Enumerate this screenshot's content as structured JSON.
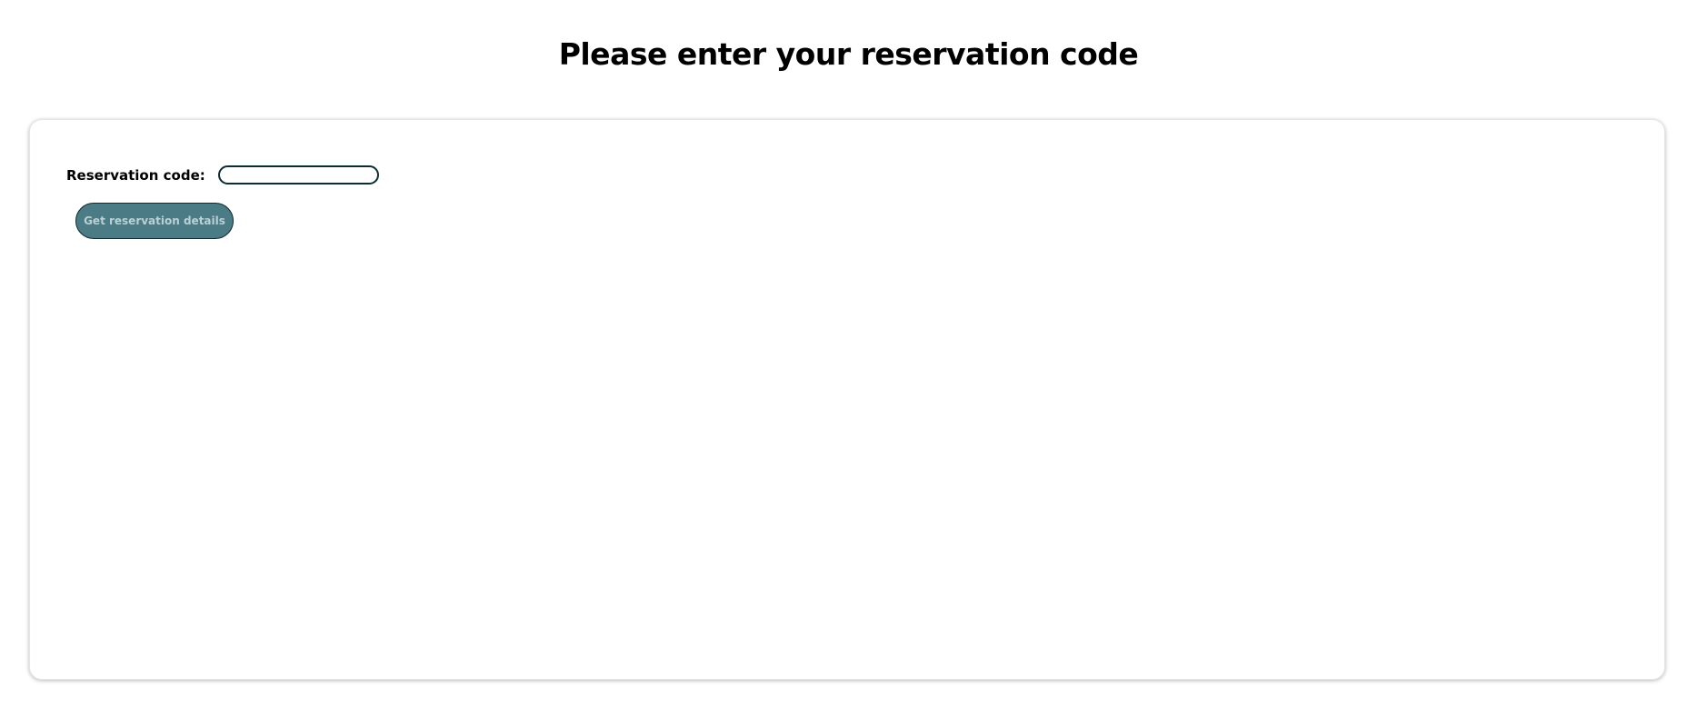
{
  "header": {
    "title": "Please enter your reservation code"
  },
  "form": {
    "code_label": "Reservation code:",
    "code_value": "",
    "submit_label": "Get reservation details"
  },
  "colors": {
    "button_bg": "#4b7b84",
    "button_text": "#b9d0d4",
    "input_border": "#0d2b33"
  }
}
